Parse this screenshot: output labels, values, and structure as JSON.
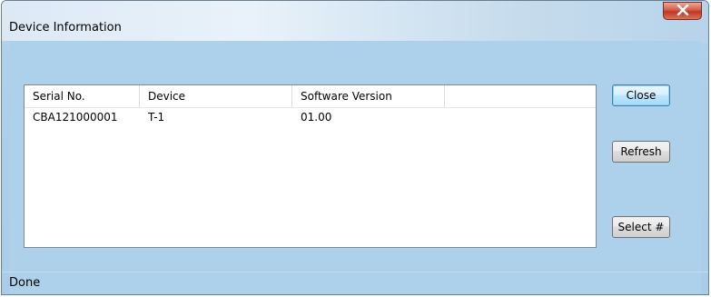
{
  "window": {
    "title": "Device Information",
    "close_glyph": "X"
  },
  "list": {
    "columns": [
      "Serial No.",
      "Device",
      "Software Version",
      ""
    ],
    "rows": [
      [
        "CBA121000001",
        "T-1",
        "01.00",
        ""
      ]
    ]
  },
  "buttons": {
    "close": "Close",
    "refresh": "Refresh",
    "select": "Select #"
  },
  "status": {
    "text": "Done"
  }
}
